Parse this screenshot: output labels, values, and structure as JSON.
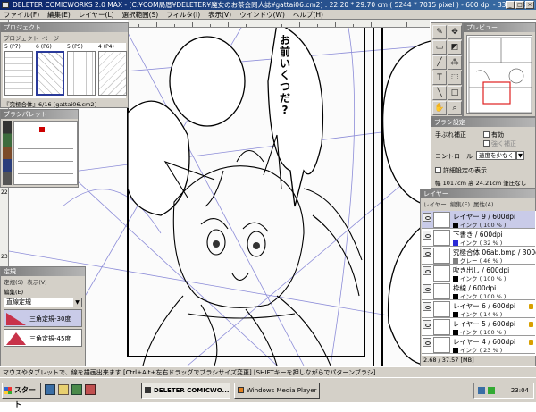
{
  "window": {
    "title": "DELETER COMICWORKS  2.0 MAX - [C:¥COM局厝¥DELETER¥魔女のお茶会同人誌¥gattai06.cm2] : 22.20 * 29.70 cm ( 5244 * 7015 pixel ) - 600 dpi - 33.3%表示]",
    "min_glyph": "_",
    "max_glyph": "□",
    "close_glyph": "×"
  },
  "menu": [
    "ファイル(F)",
    "編集(E)",
    "レイヤー(L)",
    "選択範囲(S)",
    "フィルタ(I)",
    "表示(V)",
    "ウインドウ(W)",
    "ヘルプ(H)"
  ],
  "ruler": {
    "v_labels": [
      "21",
      "22",
      "23",
      "24"
    ]
  },
  "canvas": {
    "speech_text": [
      "お",
      "前",
      "い",
      "く",
      "つ",
      "だ",
      "?"
    ]
  },
  "project_panel": {
    "title": "プロジェクト",
    "tabs": [
      "プロジェクト",
      "ページ"
    ],
    "page_labels": [
      "5 (P7)",
      "6 (P6)",
      "5 (P5)",
      "4 (P4)"
    ],
    "footer": "『究極合体』6/16 [gattai06.cm2]"
  },
  "brush_panel": {
    "title": "ブラシパレット"
  },
  "ruler_panel": {
    "title": "定規",
    "tabs": [
      "定規(S)",
      "表示(V)"
    ],
    "menu": "編集(E)",
    "select": "直線定規",
    "items": [
      "三角定規-30度",
      "三角定規-45度"
    ]
  },
  "preview_panel": {
    "title": "プレビュー"
  },
  "brush_settings": {
    "title": "ブラシ設定",
    "hand_correction": "手ぶれ補正",
    "enabled": "有効",
    "strong": "強く補正",
    "control": "コントロール",
    "control_value": "速度を少なく",
    "detail": "詳細設定の表示",
    "size": "幅 1017cm  高 24.21cm  筆圧なし"
  },
  "layer_panel": {
    "title": "レイヤー",
    "tabs": [
      "レイヤー",
      "編集(E)",
      "属性(A)"
    ],
    "layers": [
      {
        "name": "レイヤー 9 / 600dpi",
        "sub": "インク ( 100 % )",
        "color": "#000000",
        "selected": true,
        "lock": false
      },
      {
        "name": "下書き / 600dpi",
        "sub": "インク ( 32 % )",
        "color": "#2b2bd6",
        "selected": false,
        "lock": false
      },
      {
        "name": "究極合体 06ab.bmp / 300dpi",
        "sub": "グレー ( 46 % )",
        "color": "#808080",
        "selected": false,
        "lock": false
      },
      {
        "name": "吹き出し / 600dpi",
        "sub": "インク ( 100 % )",
        "color": "#000000",
        "selected": false,
        "lock": false
      },
      {
        "name": "枠線 / 600dpi",
        "sub": "インク ( 100 % )",
        "color": "#000000",
        "selected": false,
        "lock": false
      },
      {
        "name": "レイヤー 6 / 600dpi",
        "sub": "インク ( 14 % )",
        "color": "#000000",
        "selected": false,
        "lock": true
      },
      {
        "name": "レイヤー 5 / 600dpi",
        "sub": "インク ( 100 % )",
        "color": "#000000",
        "selected": false,
        "lock": true
      },
      {
        "name": "レイヤー 4 / 600dpi",
        "sub": "インク ( 23 % )",
        "color": "#000000",
        "selected": false,
        "lock": true
      }
    ],
    "memory": "2.68 / 37.57 [MB]"
  },
  "status_text": "マウスやタブレットで、線を描画出来ます  [Ctrl+Alt+左右ドラッグでブラシサイズ変更]  [SHIFTキーを押しながらでパターンブラシ]",
  "taskbar": {
    "start": "スタート",
    "buttons": [
      "DELETER COMICWO...",
      "Windows Media Player"
    ],
    "clock": "23:04"
  }
}
